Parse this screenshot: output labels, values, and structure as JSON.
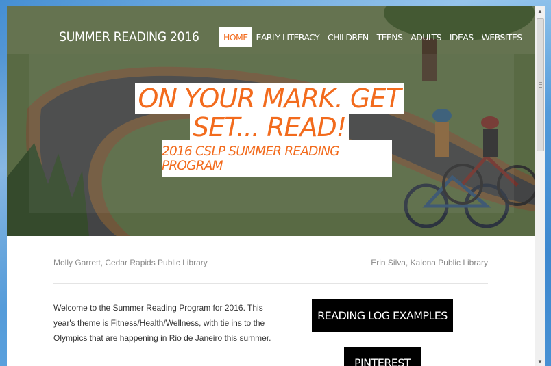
{
  "site": {
    "title": "SUMMER READING 2016"
  },
  "nav": {
    "items": [
      {
        "label": "HOME",
        "active": true
      },
      {
        "label": "EARLY LITERACY",
        "active": false
      },
      {
        "label": "CHILDREN",
        "active": false
      },
      {
        "label": "TEENS",
        "active": false
      },
      {
        "label": "ADULTS",
        "active": false
      },
      {
        "label": "IDEAS",
        "active": false
      },
      {
        "label": "WEBSITES",
        "active": false
      }
    ]
  },
  "hero": {
    "headline": "ON YOUR MARK. GET SET... READ!",
    "subheadline": "2016 CSLP SUMMER READING PROGRAM"
  },
  "credits": {
    "left": "Molly Garrett, Cedar Rapids Public Library",
    "right": "Erin Silva, Kalona Public Library"
  },
  "intro": {
    "text": "Welcome to the Summer Reading Program for 2016. This year's theme is Fitness/Health/Wellness, with tie ins to the Olympics that are happening in Rio de Janeiro this summer."
  },
  "buttons": {
    "reading_log": "READING LOG EXAMPLES",
    "pinterest": "PINTEREST"
  },
  "colors": {
    "accent": "#f26b1d",
    "button_bg": "#000000",
    "backdrop": "#3f8fd6"
  }
}
